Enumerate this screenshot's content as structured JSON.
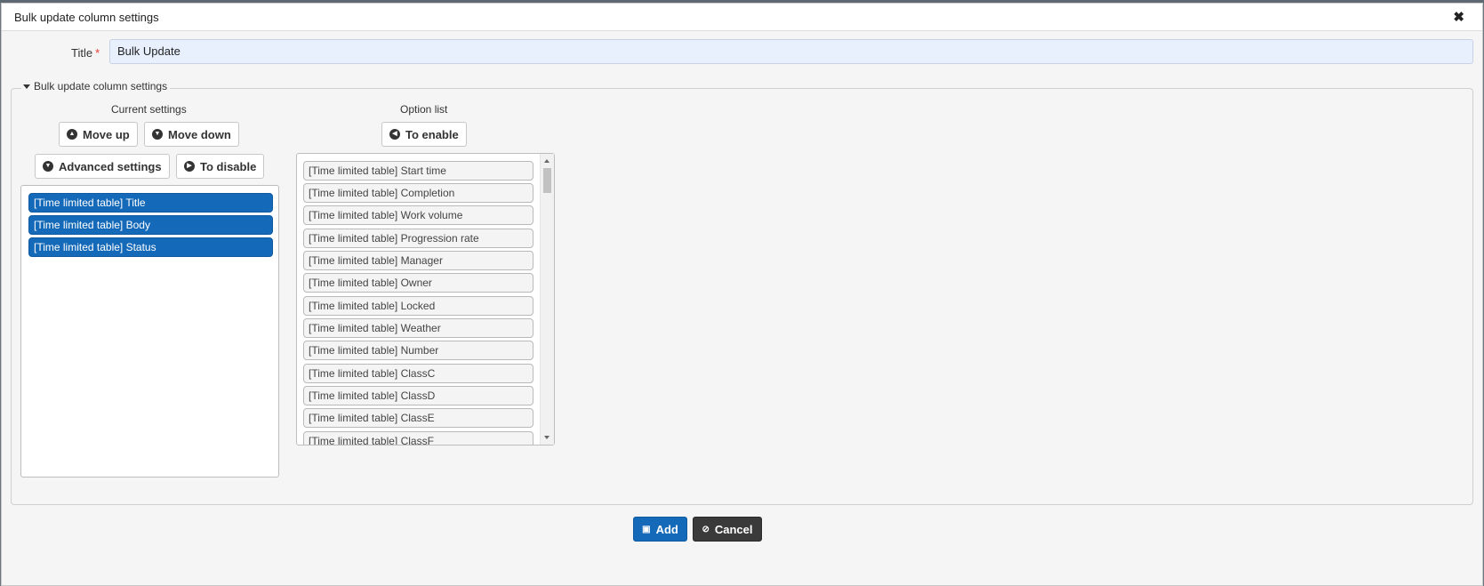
{
  "dialog": {
    "title": "Bulk update column settings",
    "close_icon": "close-icon"
  },
  "title_field": {
    "label": "Title",
    "required_mark": "*",
    "value": "Bulk Update"
  },
  "section": {
    "legend": "Bulk update column settings"
  },
  "current": {
    "header": "Current settings",
    "move_up": "Move up",
    "move_down": "Move down",
    "advanced": "Advanced settings",
    "disable": "To disable",
    "items": [
      "[Time limited table] Title",
      "[Time limited table] Body",
      "[Time limited table] Status"
    ]
  },
  "options": {
    "header": "Option list",
    "enable": "To enable",
    "items": [
      "[Time limited table] Start time",
      "[Time limited table] Completion",
      "[Time limited table] Work volume",
      "[Time limited table] Progression rate",
      "[Time limited table] Manager",
      "[Time limited table] Owner",
      "[Time limited table] Locked",
      "[Time limited table] Weather",
      "[Time limited table] Number",
      "[Time limited table] ClassC",
      "[Time limited table] ClassD",
      "[Time limited table] ClassE",
      "[Time limited table] ClassF"
    ]
  },
  "footer": {
    "add": "Add",
    "cancel": "Cancel"
  },
  "colors": {
    "primary": "#1469b8",
    "dark": "#3a3a3a",
    "title_input_bg": "#e8f0fe"
  }
}
